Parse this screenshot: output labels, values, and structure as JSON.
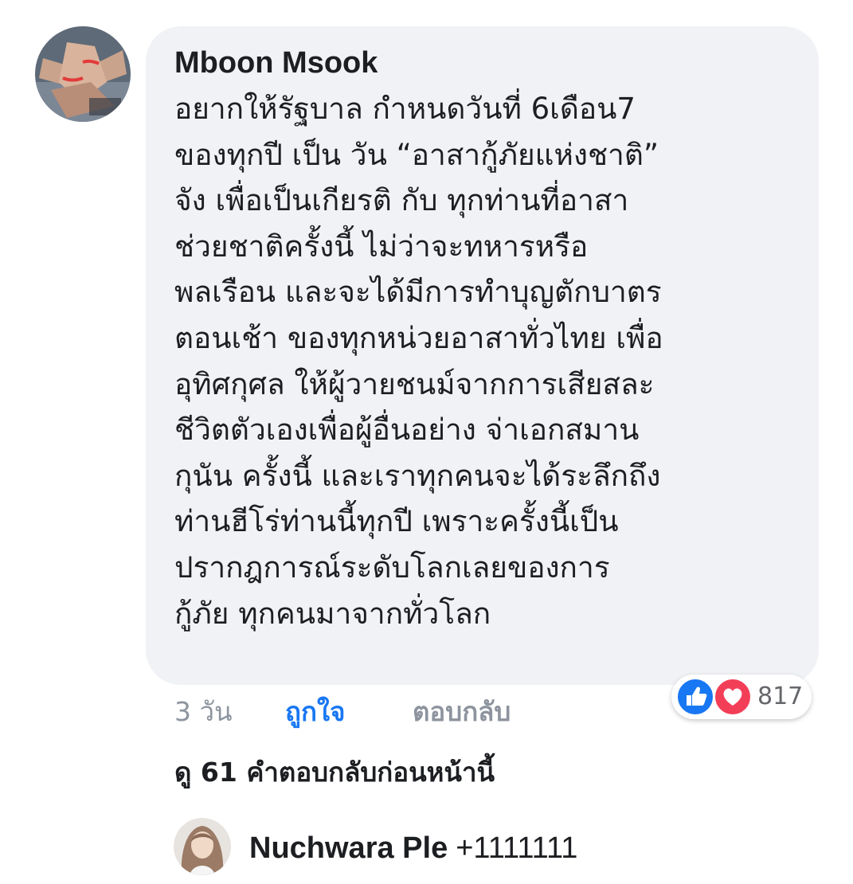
{
  "comment": {
    "author": "Mboon Msook",
    "text": "อยากให้รัฐบาล กำหนดวันที่ 6เดือน7\nของทุกปี เป็น วัน “อาสากู้ภัยแห่งชาติ”\nจัง เพื่อเป็นเกียรติ กับ ทุกท่านที่อาสา\nช่วยชาติครั้งนี้ ไม่ว่าจะทหารหรือ\nพลเรือน และจะได้มีการทำบุญตักบาตร\nตอนเช้า ของทุกหน่วยอาสาทั่วไทย เพื่อ\nอุทิศกุศล ให้ผู้วายชนม์จากการเสียสละ\nชีวิตตัวเองเพื่อผู้อื่นอย่าง จ่าเอกสมาน\nกุนัน ครั้งนี้ และเราทุกคนจะได้ระลึกถึง\nท่านฮีโร่ท่านนี้ทุกปี  เพราะครั้งนี้เป็น\nปรากฎการณ์ระดับโลกเลยของการ\nกู้ภัย ทุกคนมาจากทั่วโลก",
    "time": "3 วัน",
    "like_label": "ถูกใจ",
    "reply_label": "ตอบกลับ",
    "reactions": {
      "icons": [
        "like-icon",
        "love-icon"
      ],
      "count": "817"
    }
  },
  "view_more_label": "ดู 61 คำตอบกลับก่อนหน้านี้",
  "reply_preview": {
    "author": "Nuchwara Ple",
    "text": "+1111111"
  },
  "colors": {
    "bubble": "#f0f2f5",
    "link_blue": "#1877f2",
    "muted": "#8d949e",
    "text": "#1c1e21",
    "love": "#f33e58"
  }
}
